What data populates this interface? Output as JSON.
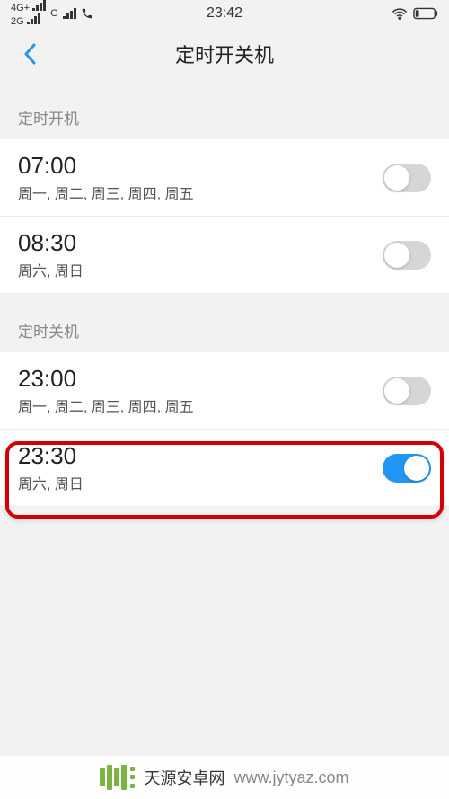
{
  "status_bar": {
    "net1": "4G+",
    "net2": "2G",
    "net3_label": "G",
    "time": "23:42"
  },
  "nav": {
    "title": "定时开关机"
  },
  "sections": {
    "power_on": {
      "header": "定时开机",
      "items": [
        {
          "time": "07:00",
          "days": "周一, 周二, 周三, 周四, 周五",
          "enabled": false
        },
        {
          "time": "08:30",
          "days": "周六, 周日",
          "enabled": false
        }
      ]
    },
    "power_off": {
      "header": "定时关机",
      "items": [
        {
          "time": "23:00",
          "days": "周一, 周二, 周三, 周四, 周五",
          "enabled": false
        },
        {
          "time": "23:30",
          "days": "周六, 周日",
          "enabled": true
        }
      ]
    }
  },
  "watermark": {
    "text": "天源安卓网",
    "url": "www.jytyaz.com"
  }
}
